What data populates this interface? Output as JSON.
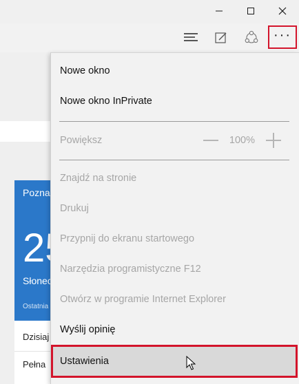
{
  "window_controls": {
    "minimize_icon": "minimize-icon",
    "maximize_icon": "maximize-icon",
    "close_icon": "close-icon"
  },
  "toolbar": {
    "hub_icon": "hub-icon",
    "note_icon": "web-note-icon",
    "share_icon": "share-icon",
    "more_label": "···"
  },
  "background_page": {
    "weather_title": "Pozna",
    "weather_temp": "25",
    "weather_condition": "Słonec",
    "weather_updated": "Ostatnia",
    "forecast": [
      "Dzisiaj",
      "Pełna"
    ]
  },
  "menu": {
    "new_window": "Nowe okno",
    "new_private_window": "Nowe okno InPrivate",
    "zoom_label": "Powiększ",
    "zoom_value": "100%",
    "find_on_page": "Znajdź na stronie",
    "print": "Drukuj",
    "pin_to_start": "Przypnij do ekranu startowego",
    "f12_tools": "Narzędzia programistyczne F12",
    "open_in_ie": "Otwórz w programie Internet Explorer",
    "send_feedback": "Wyślij opinię",
    "settings": "Ustawienia"
  },
  "colors": {
    "highlight_border": "#d3142b",
    "weather_tile": "#2b78c9",
    "disabled_text": "#a6a6a6"
  }
}
